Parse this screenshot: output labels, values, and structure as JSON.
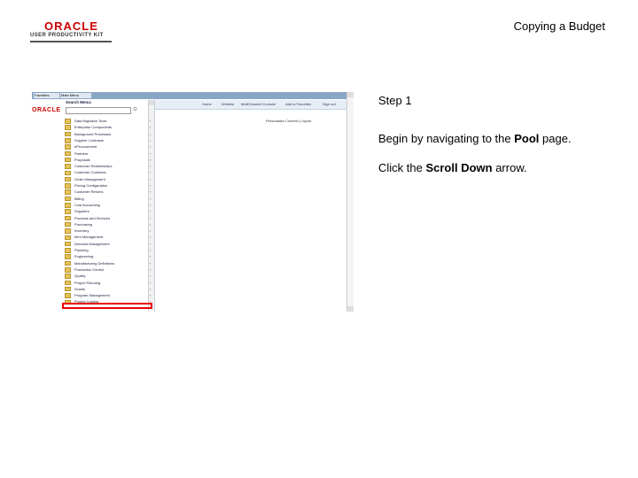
{
  "logo": {
    "word": "ORACLE",
    "subtitle": "USER PRODUCTIVITY KIT"
  },
  "doc_title": "Copying a Budget",
  "screenshot": {
    "favorites_label": "Favorites",
    "main_menu_label": "Main Menu",
    "oracle_logo": "ORACLE",
    "search_menu_label": "Search Menu:",
    "nav_links": [
      "Home",
      "Worklist",
      "MultiChannel Console",
      "Add to Favorites",
      "Sign out"
    ],
    "personalize_text": "Personalize Content | Layout",
    "menu_items": [
      {
        "label": "Data Migration Tools",
        "arrow": "›"
      },
      {
        "label": "Enterprise Components",
        "arrow": "›"
      },
      {
        "label": "Background Processes",
        "arrow": "›"
      },
      {
        "label": "Supplier Contracts",
        "arrow": "›"
      },
      {
        "label": "eProcurement",
        "arrow": "›"
      },
      {
        "label": "Partners",
        "arrow": "›"
      },
      {
        "label": "Proposals",
        "arrow": "›"
      },
      {
        "label": "Customer Relationships",
        "arrow": "›"
      },
      {
        "label": "Customer Contracts",
        "arrow": "›"
      },
      {
        "label": "Order Management",
        "arrow": "›"
      },
      {
        "label": "Pricing Configuration",
        "arrow": "›"
      },
      {
        "label": "Customer Returns",
        "arrow": "›"
      },
      {
        "label": "Billing",
        "arrow": "›"
      },
      {
        "label": "Cost Accounting",
        "arrow": "›"
      },
      {
        "label": "Suppliers",
        "arrow": "›"
      },
      {
        "label": "Products and Services",
        "arrow": "›"
      },
      {
        "label": "Purchasing",
        "arrow": "›"
      },
      {
        "label": "Inventory",
        "arrow": "›"
      },
      {
        "label": "Item Management",
        "arrow": "›"
      },
      {
        "label": "Demand Management",
        "arrow": "›"
      },
      {
        "label": "Planning",
        "arrow": "›"
      },
      {
        "label": "Engineering",
        "arrow": "›"
      },
      {
        "label": "Manufacturing Definitions",
        "arrow": "›"
      },
      {
        "label": "Production Control",
        "arrow": "›"
      },
      {
        "label": "Quality",
        "arrow": "›"
      },
      {
        "label": "Project Planning",
        "arrow": "›"
      },
      {
        "label": "Grants",
        "arrow": "›"
      },
      {
        "label": "Program Management",
        "arrow": "›"
      },
      {
        "label": "Project Costing",
        "arrow": "›"
      }
    ]
  },
  "step": "Step 1",
  "instruction1": {
    "pre": "Begin by navigating to the ",
    "bold": "Pool",
    "post": " page."
  },
  "instruction2": {
    "pre": "Click the ",
    "bold": "Scroll Down",
    "post": " arrow."
  }
}
